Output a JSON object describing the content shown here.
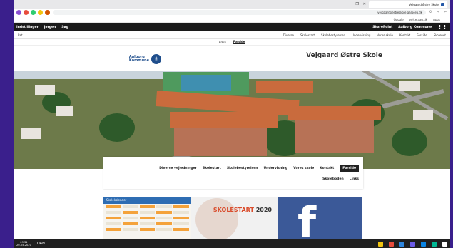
{
  "browser": {
    "tab_title": "Vejgaard Østre Skole",
    "url": "vejgaardoestreskole.aalborg.dk",
    "window_controls": [
      "—",
      "❐",
      "✕"
    ],
    "nav_icons": [
      "back-icon",
      "forward-icon",
      "reload-icon"
    ],
    "bookmarks": [
      "Apps",
      "voice.aau.dk",
      "Google"
    ]
  },
  "sharepoint": {
    "app_name": "Aalborg Kommune",
    "site_label": "SharePoint",
    "right_items": [
      "Søg",
      "Jørgen",
      "Indstillinger"
    ]
  },
  "ribbon": [
    "Skolenet",
    "Forside",
    "Kontakt",
    "Vores skole",
    "Undervisning",
    "Skolebestyrelsen",
    "Skolestart",
    "Diverse",
    "Ret"
  ],
  "subtabs": {
    "items": [
      "Forside",
      "Arkiv"
    ],
    "active": "Forside"
  },
  "header": {
    "site_title": "Vejgaard Østre Skole",
    "logo_lines": [
      "Aalborg",
      "Kommune"
    ]
  },
  "nav": {
    "row1": [
      "Forside",
      "Kontakt",
      "Vores skole",
      "Undervisning",
      "Skolebestyrelsen",
      "Skolestart",
      "Diverse vejledninger"
    ],
    "row2": [
      "Links",
      "Skoleboden"
    ]
  },
  "tiles": {
    "facebook_letter": "f",
    "skolestart": {
      "word": "SKOLESTART",
      "year": "2020"
    },
    "calendar_title": "Skolekalender"
  },
  "taskbar": {
    "time": "09.31",
    "date": "20-05-2020",
    "lang": "DAN"
  },
  "colors": {
    "accent": "#1f4e8c",
    "facebook": "#3b5998",
    "desktop": "#3a1f8c"
  }
}
